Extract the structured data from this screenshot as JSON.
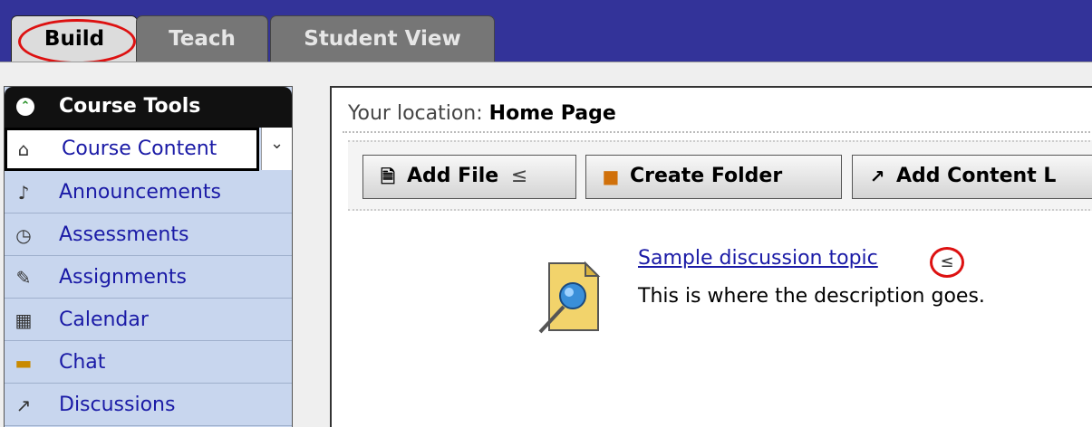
{
  "tabs": [
    {
      "label": "Build"
    },
    {
      "label": "Teach"
    },
    {
      "label": "Student View"
    }
  ],
  "course_tools": {
    "title": "Course Tools",
    "items": [
      {
        "label": "Course Content",
        "icon": "home-icon"
      },
      {
        "label": "Announcements",
        "icon": "megaphone-icon"
      },
      {
        "label": "Assessments",
        "icon": "assessment-icon"
      },
      {
        "label": "Assignments",
        "icon": "assignment-icon"
      },
      {
        "label": "Calendar",
        "icon": "calendar-icon"
      },
      {
        "label": "Chat",
        "icon": "chat-icon"
      },
      {
        "label": "Discussions",
        "icon": "pushpin-icon"
      }
    ]
  },
  "location": {
    "label": "Your location:",
    "value": "Home Page"
  },
  "toolbar": {
    "add_file": "Add File",
    "create_folder": "Create Folder",
    "add_content_link": "Add Content L"
  },
  "item": {
    "title": "Sample discussion topic",
    "description": "This is where the description goes."
  },
  "colors": {
    "topbar": "#333399",
    "highlight": "#dd1111",
    "link": "#1a1aa6",
    "sidebar": "#c8d6ee"
  }
}
